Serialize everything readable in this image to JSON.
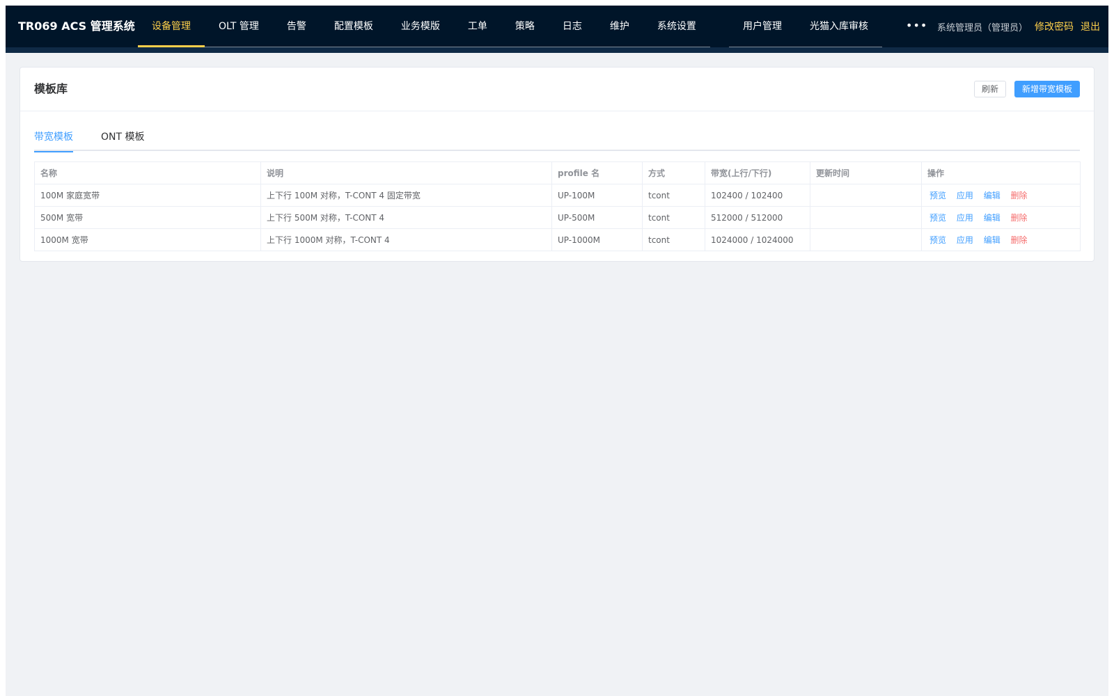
{
  "header": {
    "brand": "TR069 ACS 管理系统",
    "nav_primary": [
      {
        "label": "设备管理",
        "active": true
      },
      {
        "label": "OLT 管理"
      },
      {
        "label": "告警"
      },
      {
        "label": "配置模板"
      },
      {
        "label": "业务模版"
      },
      {
        "label": "工单"
      },
      {
        "label": "策略"
      },
      {
        "label": "日志"
      },
      {
        "label": "维护"
      },
      {
        "label": "系统设置"
      }
    ],
    "nav_secondary": [
      {
        "label": "用户管理"
      },
      {
        "label": "光猫入库审核"
      }
    ],
    "more_label": "•••",
    "user": "系统管理员（管理员）",
    "change_password": "修改密码",
    "logout": "退出"
  },
  "card": {
    "title": "模板库",
    "refresh_label": "刷新",
    "add_label": "新增带宽模板"
  },
  "tabs": [
    {
      "label": "带宽模板",
      "active": true
    },
    {
      "label": "ONT 模板"
    }
  ],
  "table": {
    "columns": [
      "名称",
      "说明",
      "profile 名",
      "方式",
      "带宽(上行/下行)",
      "更新时间",
      "操作"
    ],
    "rows": [
      {
        "name": "100M 家庭宽带",
        "desc": "上下行 100M 对称，T-CONT 4 固定带宽",
        "profile": "UP-100M",
        "mode": "tcont",
        "bw": "102400 / 102400",
        "updated": ""
      },
      {
        "name": "500M 宽带",
        "desc": "上下行 500M 对称，T-CONT 4",
        "profile": "UP-500M",
        "mode": "tcont",
        "bw": "512000 / 512000",
        "updated": ""
      },
      {
        "name": "1000M 宽带",
        "desc": "上下行 1000M 对称，T-CONT 4",
        "profile": "UP-1000M",
        "mode": "tcont",
        "bw": "1024000 / 1024000",
        "updated": ""
      }
    ],
    "actions": {
      "preview": "预览",
      "apply": "应用",
      "edit": "编辑",
      "delete": "删除"
    }
  },
  "colors": {
    "header_bg": "#001529",
    "accent_yellow": "#ffd04b",
    "primary_blue": "#409eff",
    "danger_red": "#f56c6c"
  }
}
